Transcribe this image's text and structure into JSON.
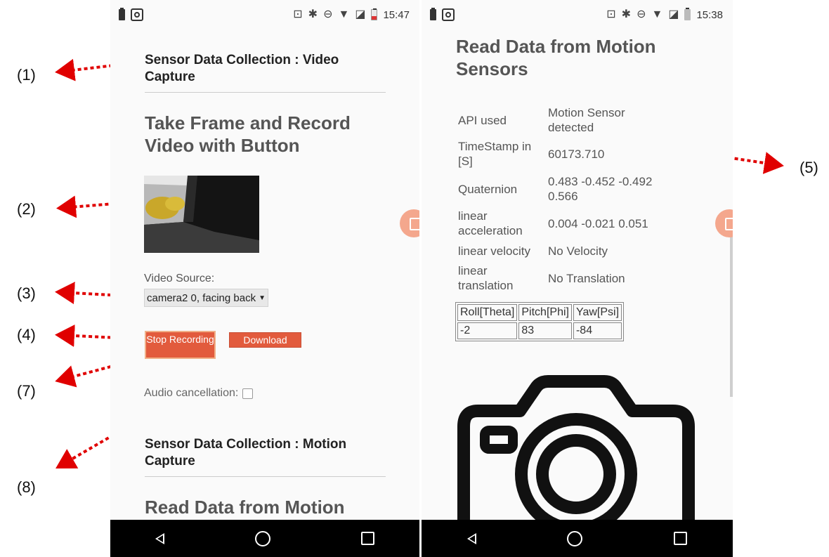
{
  "callouts": [
    "(1)",
    "(2)",
    "(3)",
    "(4)",
    "(7)",
    "(8)",
    "(5)"
  ],
  "left_phone": {
    "status": {
      "time": "15:47"
    },
    "section1_title": "Sensor Data Collection : Video Capture",
    "heading1": "Take Frame and Record Video with Button",
    "video_source_label": "Video Source:",
    "video_source_value": "camera2 0, facing back",
    "stop_button": "Stop Recording",
    "download_button": "Download",
    "audio_label": "Audio cancellation:",
    "section2_title": "Sensor Data Collection : Motion Capture",
    "heading2": "Read Data from Motion"
  },
  "right_phone": {
    "status": {
      "time": "15:38"
    },
    "heading": "Read Data from Motion Sensors",
    "rows": [
      {
        "key": "API used",
        "value": "Motion Sensor detected"
      },
      {
        "key": "TimeStamp in [S]",
        "value": "60173.710"
      },
      {
        "key": "Quaternion",
        "value": "0.483 -0.452 -0.492 0.566"
      },
      {
        "key": "linear acceleration",
        "value": "0.004 -0.021 0.051"
      },
      {
        "key": "linear velocity",
        "value": "No Velocity"
      },
      {
        "key": "linear translation",
        "value": "No Translation"
      }
    ],
    "angles": {
      "headers": [
        "Roll[Theta]",
        "Pitch[Phi]",
        "Yaw[Psi]"
      ],
      "values": [
        "-2",
        "83",
        "-84"
      ]
    }
  },
  "colors": {
    "button": "#e25b3d",
    "arrow": "#e00000",
    "navbar": "#000000"
  }
}
